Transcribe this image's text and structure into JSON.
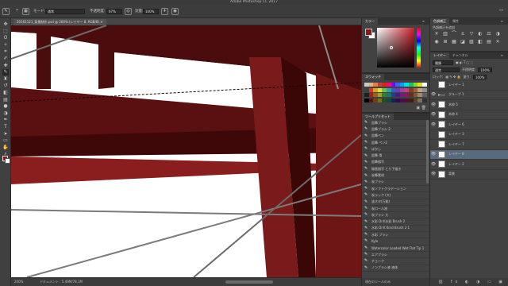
{
  "app": {
    "title": "Adobe Photoshop CC 2017"
  },
  "options_bar": {
    "mode_label": "モード:",
    "mode_value": "通常",
    "opacity_label": "不透明度:",
    "opacity_value": "67%",
    "flow_label": "流量:",
    "flow_value": "100%"
  },
  "document": {
    "tab_title": "20161121_背景制作.psd @ 200% (レイヤー 8, RGB/8)"
  },
  "tools": [
    "move-icon",
    "marquee-icon",
    "lasso-icon",
    "magic-wand-icon",
    "crop-icon",
    "eyedropper-icon",
    "healing-icon",
    "brush-icon",
    "stamp-icon",
    "history-brush-icon",
    "eraser-icon",
    "gradient-icon",
    "blur-icon",
    "dodge-icon",
    "pen-icon",
    "type-icon",
    "path-select-icon",
    "shape-icon",
    "hand-icon",
    "zoom-icon",
    "ellipsis-icon"
  ],
  "status": {
    "zoom": "200%",
    "doc_info": "ドキュメント : 5.49M/78.1M"
  },
  "color_panel": {
    "tab": "カラー",
    "fg": "#8a1a1a",
    "bg": "#ffffff"
  },
  "swatch_panel": {
    "tab": "スウォッチ",
    "rows": [
      [
        "#c8c8c8",
        "#e0b090",
        "#e08040",
        "#c04040",
        "#e02020",
        "#ff0080",
        "#8000ff",
        "#4060ff",
        "#00a0ff",
        "#00e0e0",
        "#20c060",
        "#80e020",
        "#e0e020",
        "#ffffff"
      ],
      [
        "#404040",
        "#e03030",
        "#e0a020",
        "#e0e040",
        "#60c060",
        "#30a0a0",
        "#3060c0",
        "#6040c0",
        "#a040a0",
        "#c04080",
        "#804020",
        "#a06040",
        "#c0a080",
        "#909090"
      ],
      [
        "#202020",
        "#a02020",
        "#a06020",
        "#a0a030",
        "#308030",
        "#207070",
        "#204080",
        "#402080",
        "#702070",
        "#802050",
        "#603018",
        "#805838",
        "#a08868",
        "#606060"
      ],
      [
        "#000000",
        "#601010",
        "#704010",
        "#707020",
        "#205020",
        "#104848",
        "#102850",
        "#281050",
        "#481048",
        "#501030",
        "#402010",
        "#604028",
        "#807058",
        "#303030"
      ]
    ]
  },
  "presets_panel": {
    "tab": "ツールプリセット",
    "items": [
      "鉛筆ブラシ",
      "鉛筆ブラシ 2",
      "鉛筆ペン",
      "鉛筆 ペン2",
      "ぼかし",
      "鉛筆 滑",
      "鉛筆描写",
      "線画描写 とり下描き",
      "炭筆素材",
      "炭ブラシ",
      "炭ソフトグラデーション",
      "炭ラック (大)",
      "塗ネタ(万能)",
      "炭ロール液",
      "炭ブラシ 大",
      "水彩 Dr.K水彩 Brush 2",
      "水彩 Dr.K Kind Brush 2 1",
      "水彩 ブラシ",
      "Kyle",
      "Watercolor Loaded Wet Flat Tip 1",
      "エアブラシ",
      "チョーク",
      "ノンブラシ液 液体"
    ],
    "footer": "現在のツールのみ"
  },
  "adjustments_panel": {
    "tabs": [
      "色調補正",
      "属性"
    ],
    "add_label": "色調補正を追加",
    "icons": [
      "brightness-icon",
      "levels-icon",
      "curves-icon",
      "exposure-icon",
      "vibrance-icon",
      "hue-icon",
      "colorbalance-icon",
      "bw-icon",
      "photofilter-icon",
      "channelmixer-icon",
      "lookup-icon",
      "invert-icon",
      "posterize-icon",
      "threshold-icon",
      "gradientmap-icon",
      "selectivecolor-icon"
    ]
  },
  "layers_panel": {
    "tabs": [
      "レイヤー",
      "チャンネル"
    ],
    "kind_label": "種類",
    "blend": "通常",
    "opacity_label": "不透明度:",
    "opacity_value": "100%",
    "lock_label": "ロック:",
    "fill_label": "塗り:",
    "fill_value": "100%",
    "layers": [
      {
        "name": "レイヤー 1",
        "visible": false,
        "folder": false,
        "selected": false
      },
      {
        "name": "グループ 1",
        "visible": true,
        "folder": true,
        "selected": false
      },
      {
        "name": "木枠 5",
        "visible": true,
        "folder": false,
        "selected": false
      },
      {
        "name": "木枠 4",
        "visible": true,
        "folder": false,
        "selected": false
      },
      {
        "name": "レイヤー 6",
        "visible": true,
        "folder": false,
        "selected": false
      },
      {
        "name": "レイヤー 3",
        "visible": false,
        "folder": false,
        "selected": false
      },
      {
        "name": "レイヤー 7",
        "visible": false,
        "folder": false,
        "selected": false
      },
      {
        "name": "レイヤー 8",
        "visible": true,
        "folder": false,
        "selected": true
      },
      {
        "name": "レイヤー 2",
        "visible": true,
        "folder": false,
        "selected": false
      },
      {
        "name": "背景",
        "visible": true,
        "folder": false,
        "selected": false
      }
    ]
  }
}
